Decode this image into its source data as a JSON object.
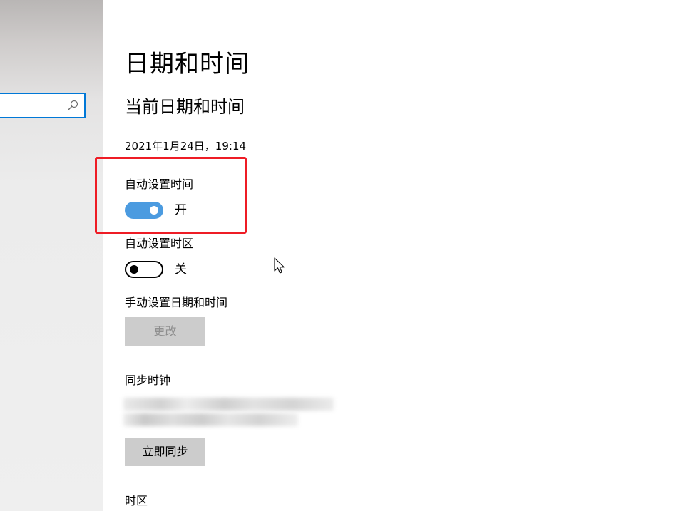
{
  "sidebar": {
    "search": {
      "value": "",
      "icon": "search-icon"
    }
  },
  "main": {
    "title": "日期和时间",
    "section_title": "当前日期和时间",
    "current_datetime": "2021年1月24日，19:14",
    "auto_time": {
      "label": "自动设置时间",
      "state": "开",
      "on": true
    },
    "auto_timezone": {
      "label": "自动设置时区",
      "state": "关",
      "on": false
    },
    "manual": {
      "label": "手动设置日期和时间",
      "button": "更改",
      "button_enabled": false
    },
    "sync": {
      "label": "同步时钟",
      "button": "立即同步"
    },
    "timezone": {
      "label": "时区"
    }
  },
  "colors": {
    "accent": "#0078d7",
    "toggle_on": "#4b9be0",
    "highlight": "#ee1c25",
    "button_bg": "#cccccc",
    "disabled_text": "#8f8f8f"
  }
}
